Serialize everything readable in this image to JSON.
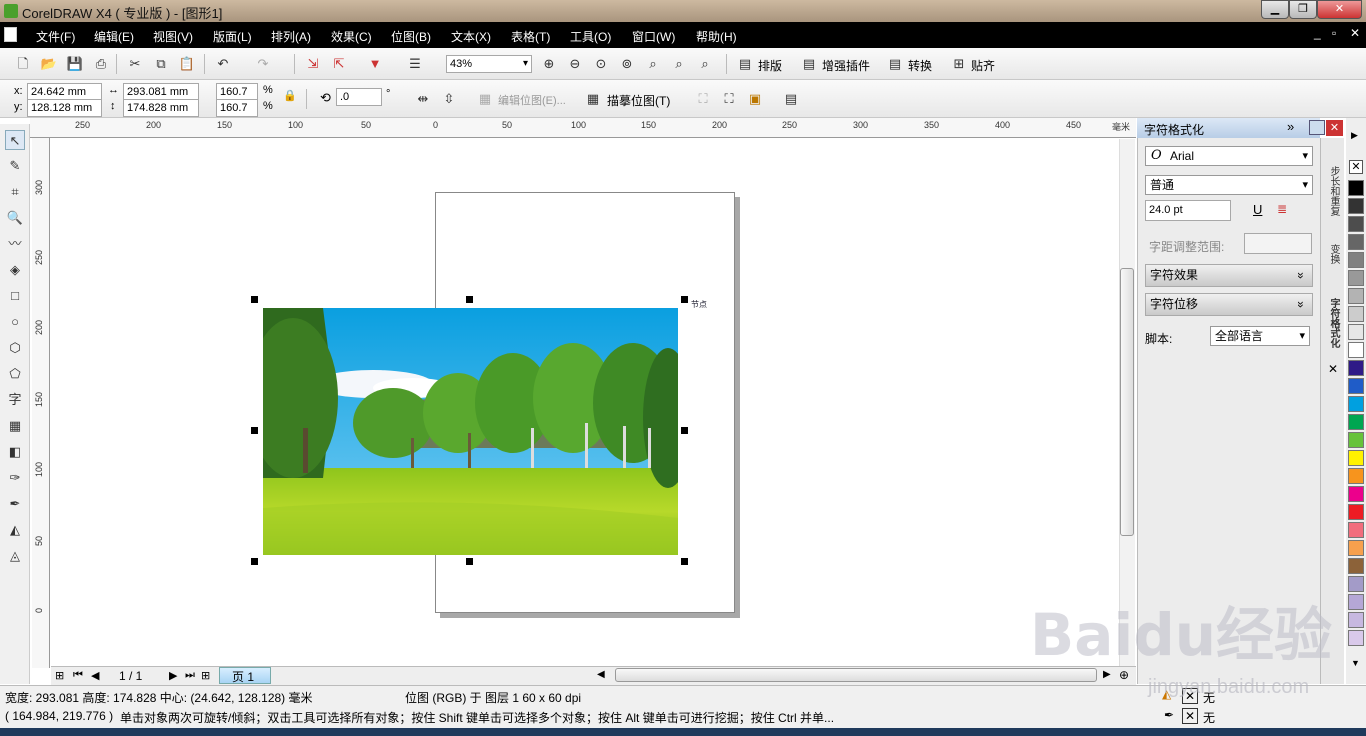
{
  "window": {
    "title": "CorelDRAW X4 ( 专业版 ) - [图形1]",
    "btn_min": "▁",
    "btn_max": "❐",
    "btn_close": "✕"
  },
  "menu": [
    "文件(F)",
    "编辑(E)",
    "视图(V)",
    "版面(L)",
    "排列(A)",
    "效果(C)",
    "位图(B)",
    "文本(X)",
    "表格(T)",
    "工具(O)",
    "窗口(W)",
    "帮助(H)"
  ],
  "menu_right": {
    "min": "_",
    "restore": "▫",
    "close": "✕"
  },
  "toolbar": {
    "zoom": "43%",
    "btn_layout": "排版",
    "btn_plugin": "增强插件",
    "btn_convert": "转换",
    "btn_snap": "贴齐"
  },
  "property": {
    "x_label": "x:",
    "x": "24.642 mm",
    "y_label": "y:",
    "y": "128.128 mm",
    "width": "293.081 mm",
    "height": "174.828 mm",
    "scale_x": "160.7",
    "scale_y": "160.7",
    "pct": "%",
    "angle": ".0",
    "deg": "°",
    "edit_bitmap": "编辑位图(E)...",
    "trace_bitmap": "描摹位图(T)"
  },
  "ruler": {
    "h_ticks": [
      "250",
      "200",
      "150",
      "100",
      "50",
      "0",
      "50",
      "100",
      "150",
      "200",
      "250",
      "300",
      "350",
      "400",
      "450"
    ],
    "h_unit": "毫米",
    "v_ticks": [
      "300",
      "250",
      "200",
      "150",
      "100",
      "50",
      "0"
    ]
  },
  "canvas": {
    "node_label": "节点"
  },
  "pagenav": {
    "counter": "1 / 1",
    "page_tab": "页 1"
  },
  "docker": {
    "title": "字符格式化",
    "font": "Arial",
    "style": "普通",
    "size": "24.0 pt",
    "kerning_label": "字距调整范围:",
    "effects": "字符效果",
    "shift": "字符位移",
    "script_label": "脚本:",
    "script_value": "全部语言"
  },
  "sidetabs": [
    "步长和重复",
    "变换",
    "字符格式化"
  ],
  "palette": [
    "#000000",
    "#333333",
    "#4d4d4d",
    "#666666",
    "#808080",
    "#999999",
    "#b3b3b3",
    "#cccccc",
    "#e6e6e6",
    "#ffffff",
    "#2e1a87",
    "#1f5cc8",
    "#00a0e0",
    "#00a651",
    "#66c23b",
    "#fff200",
    "#f7941d",
    "#ec008c",
    "#ed1c24",
    "#f26d7d",
    "#f7a04d",
    "#8c6239",
    "#a39bc8",
    "#b5a7d6",
    "#c7b8e0",
    "#d9c9ea"
  ],
  "status": {
    "line1": "宽度: 293.081  高度: 174.828  中心: (24.642, 128.128)  毫米",
    "layer": "位图 (RGB) 于 图层 1 60 x 60 dpi",
    "coords": "( 164.984, 219.776 )",
    "hint": "单击对象两次可旋转/倾斜；双击工具可选择所有对象；按住 Shift 键单击可选择多个对象；按住 Alt 键单击可进行挖掘；按住 Ctrl 并单...",
    "fill": "无",
    "outline": "无"
  },
  "watermark": {
    "main": "Baidu经验",
    "sub": "jingyan.baidu.com"
  }
}
